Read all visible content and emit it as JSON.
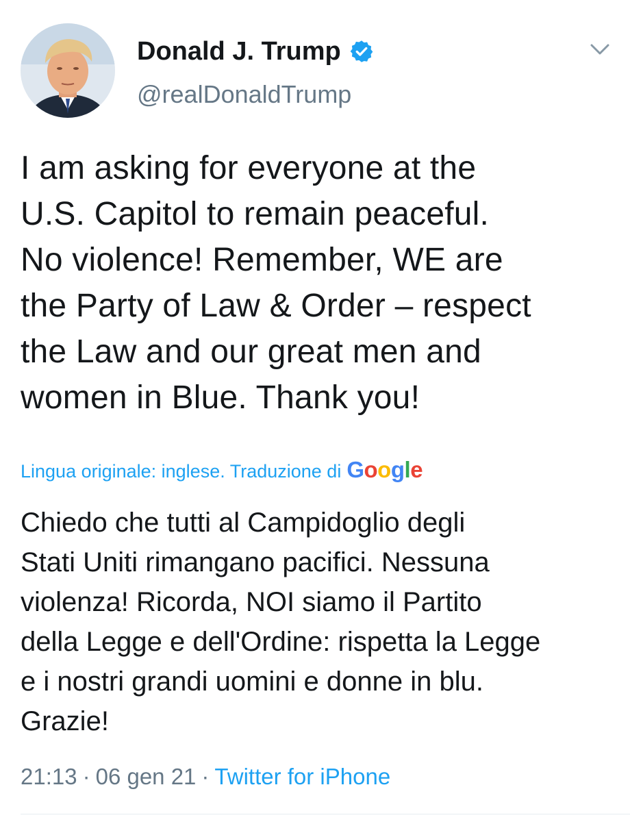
{
  "tweet": {
    "author": {
      "display_name": "Donald J. Trump",
      "handle": "@realDonaldTrump",
      "verified": true,
      "avatar_icon": "profile-photo"
    },
    "menu_icon": "chevron-down-icon",
    "text_lines": [
      "I am asking for everyone at the",
      "U.S. Capitol to remain peaceful.",
      "No violence! Remember, WE are",
      "the Party of Law & Order – respect",
      "the Law and our great men and",
      "women in Blue. Thank you!"
    ],
    "translation": {
      "notice": "Lingua originale: inglese. Traduzione di",
      "provider_letters": [
        "G",
        "o",
        "o",
        "g",
        "l",
        "e"
      ],
      "text_lines": [
        "Chiedo che tutti al Campidoglio degli",
        "Stati Uniti rimangano pacifici. Nessuna",
        "violenza! Ricorda, NOI siamo il Partito",
        "della Legge e dell'Ordine: rispetta la Legge",
        "e i nostri grandi uomini e donne in blu.",
        "Grazie!"
      ]
    },
    "meta": {
      "time": "21:13",
      "separator": "·",
      "date": "06 gen 21",
      "source": "Twitter for iPhone"
    }
  },
  "colors": {
    "text": "#14171a",
    "secondary": "#657786",
    "link": "#1da1f2",
    "verified_badge": "#1da1f2",
    "google_blue": "#4285f4",
    "google_red": "#ea4335",
    "google_yellow": "#fbbc05",
    "google_green": "#34a853"
  }
}
